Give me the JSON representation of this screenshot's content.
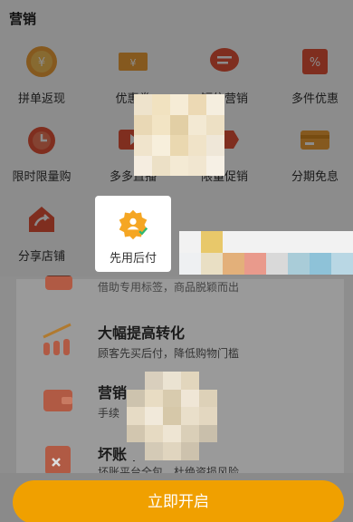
{
  "section_title": "营销",
  "tools": [
    {
      "label": "拼单返现",
      "icon": "coin-icon"
    },
    {
      "label": "优惠券",
      "icon": "coupon-icon"
    },
    {
      "label": "短信营销",
      "icon": "chat-bubble-icon"
    },
    {
      "label": "多件优惠",
      "icon": "percent-tag-icon"
    },
    {
      "label": "限时限量购",
      "icon": "alarm-clock-icon"
    },
    {
      "label": "多多直播",
      "icon": "live-video-icon"
    },
    {
      "label": "限量促销",
      "icon": "ticket-icon"
    },
    {
      "label": "分期免息",
      "icon": "credit-card-icon"
    },
    {
      "label": "分享店铺",
      "icon": "share-home-icon"
    },
    {
      "label": "先用后付",
      "icon": "badge-user-icon"
    }
  ],
  "features": [
    {
      "title": "",
      "subtitle": "借助专用标签，商品脱颖而出"
    },
    {
      "title": "大幅提高转化",
      "subtitle": "顾客先买后付，降低购物门槛"
    },
    {
      "title": "营销成本低廉",
      "subtitle": "手续"
    },
    {
      "title": "坏账平",
      "subtitle": "坏账平台全包，杜绝资损风险"
    }
  ],
  "cta_label": "立即开启",
  "colors": {
    "brand": "#f0a000",
    "accent_red": "#e8553a"
  }
}
